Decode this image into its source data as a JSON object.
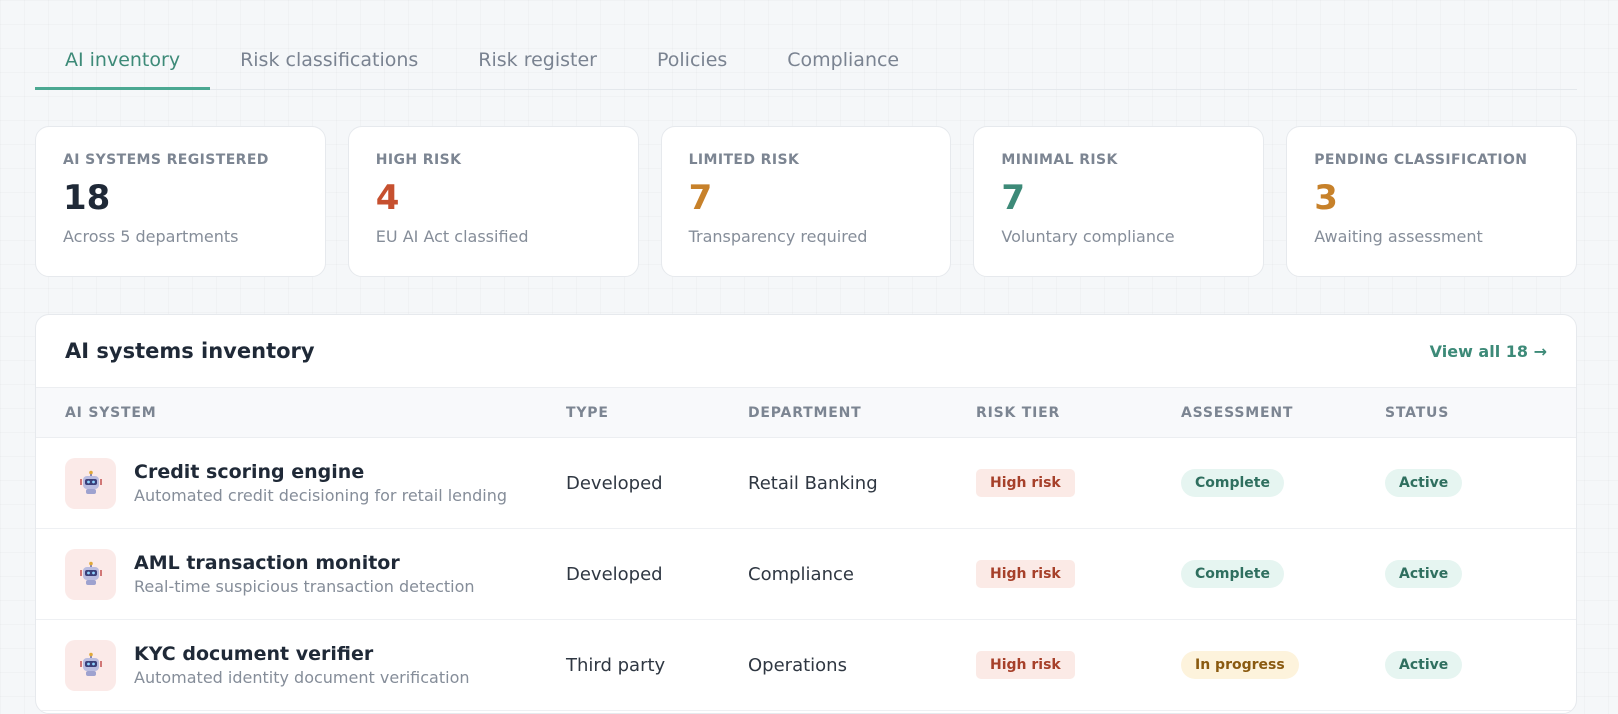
{
  "tabs": [
    "AI inventory",
    "Risk classifications",
    "Risk register",
    "Policies",
    "Compliance"
  ],
  "stats": [
    {
      "label": "AI SYSTEMS REGISTERED",
      "value": "18",
      "sub": "Across 5 departments",
      "color": "#1f2937"
    },
    {
      "label": "HIGH RISK",
      "value": "4",
      "sub": "EU AI Act classified",
      "color": "#c6502f"
    },
    {
      "label": "LIMITED RISK",
      "value": "7",
      "sub": "Transparency required",
      "color": "#c7812a"
    },
    {
      "label": "MINIMAL RISK",
      "value": "7",
      "sub": "Voluntary compliance",
      "color": "#3d8a78"
    },
    {
      "label": "PENDING CLASSIFICATION",
      "value": "3",
      "sub": "Awaiting assessment",
      "color": "#c7812a"
    }
  ],
  "inventory": {
    "title": "AI systems inventory",
    "view_all": "View all 18 →",
    "columns": [
      "AI SYSTEM",
      "TYPE",
      "DEPARTMENT",
      "RISK TIER",
      "ASSESSMENT",
      "STATUS"
    ],
    "rows": [
      {
        "icon": "robot-icon",
        "name": "Credit scoring engine",
        "desc": "Automated credit decisioning for retail lending",
        "type": "Developed",
        "department": "Retail Banking",
        "risk": "High risk",
        "assessment": "Complete",
        "status": "Active"
      },
      {
        "icon": "robot-icon",
        "name": "AML transaction monitor",
        "desc": "Real-time suspicious transaction detection",
        "type": "Developed",
        "department": "Compliance",
        "risk": "High risk",
        "assessment": "Complete",
        "status": "Active"
      },
      {
        "icon": "robot-icon",
        "name": "KYC document verifier",
        "desc": "Automated identity document verification",
        "type": "Third party",
        "department": "Operations",
        "risk": "High risk",
        "assessment": "In progress",
        "status": "Active"
      }
    ]
  }
}
